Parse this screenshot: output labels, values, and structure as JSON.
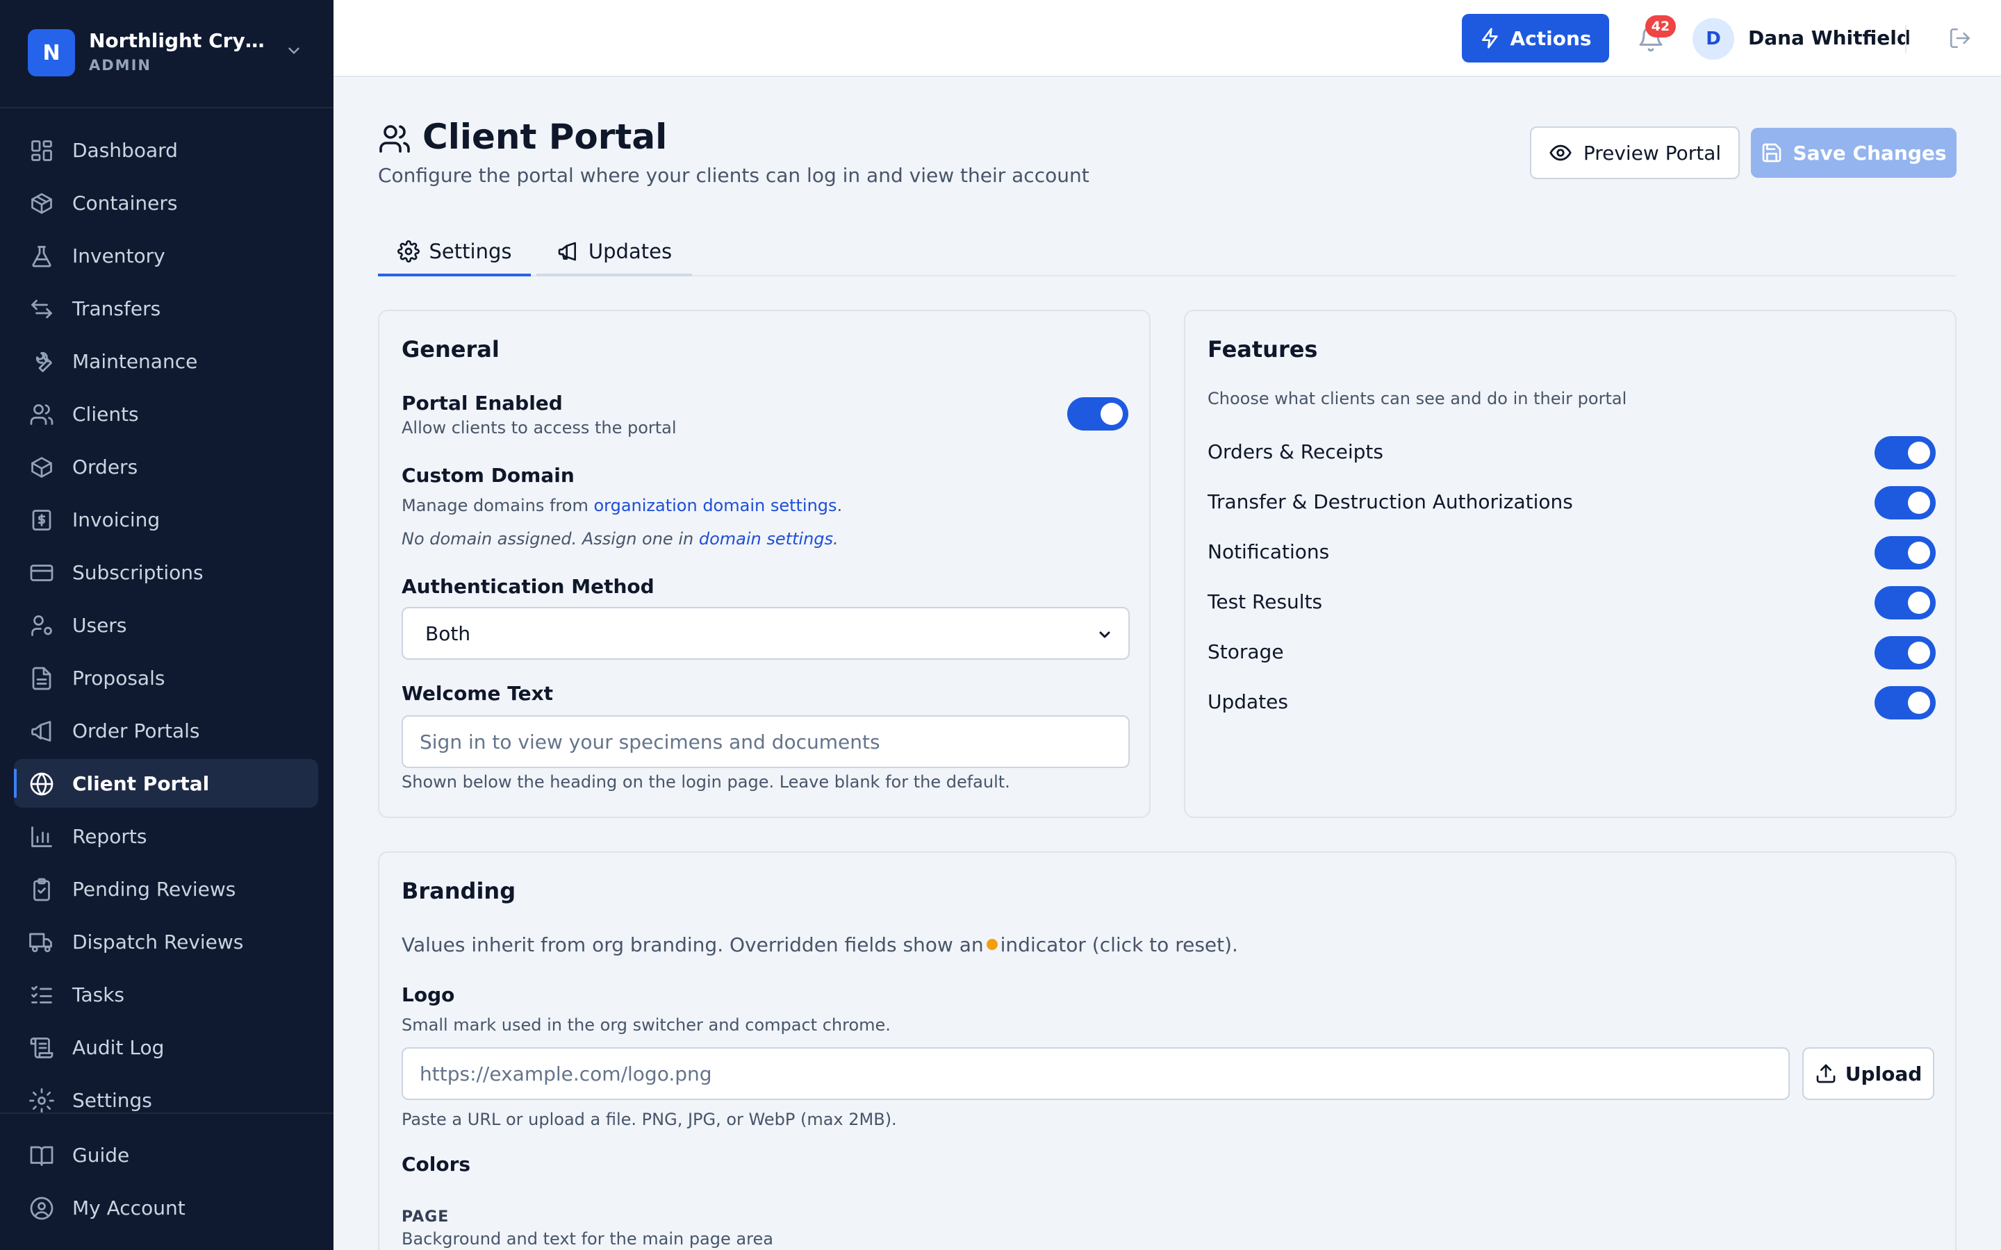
{
  "org": {
    "initial": "N",
    "name": "Northlight Cryobank",
    "role": "ADMIN"
  },
  "nav": {
    "items": [
      {
        "label": "Dashboard",
        "icon": "dashboard-icon"
      },
      {
        "label": "Containers",
        "icon": "box-icon"
      },
      {
        "label": "Inventory",
        "icon": "flask-icon"
      },
      {
        "label": "Transfers",
        "icon": "arrows-icon"
      },
      {
        "label": "Maintenance",
        "icon": "wrench-icon"
      },
      {
        "label": "Clients",
        "icon": "users-icon"
      },
      {
        "label": "Orders",
        "icon": "package-icon"
      },
      {
        "label": "Invoicing",
        "icon": "dollar-icon"
      },
      {
        "label": "Subscriptions",
        "icon": "card-icon"
      },
      {
        "label": "Users",
        "icon": "user-cog-icon"
      },
      {
        "label": "Proposals",
        "icon": "file-icon"
      },
      {
        "label": "Order Portals",
        "icon": "megaphone-icon"
      },
      {
        "label": "Client Portal",
        "icon": "globe-icon",
        "active": true
      },
      {
        "label": "Reports",
        "icon": "bar-chart-icon"
      },
      {
        "label": "Pending Reviews",
        "icon": "clipboard-icon"
      },
      {
        "label": "Dispatch Reviews",
        "icon": "truck-icon"
      },
      {
        "label": "Tasks",
        "icon": "list-check-icon"
      },
      {
        "label": "Audit Log",
        "icon": "scroll-icon"
      },
      {
        "label": "Settings",
        "icon": "gear-icon"
      }
    ],
    "bottom": [
      {
        "label": "Guide",
        "icon": "book-icon"
      },
      {
        "label": "My Account",
        "icon": "account-icon"
      }
    ]
  },
  "topbar": {
    "actions_label": "Actions",
    "notification_count": "42",
    "user_initial": "D",
    "user_name": "Dana Whitfield"
  },
  "header": {
    "title": "Client Portal",
    "subtitle": "Configure the portal where your clients can log in and view their account",
    "preview_label": "Preview Portal",
    "save_label": "Save Changes"
  },
  "tabs": {
    "settings": "Settings",
    "updates": "Updates"
  },
  "general": {
    "title": "General",
    "portal_enabled_label": "Portal Enabled",
    "portal_enabled_desc": "Allow clients to access the portal",
    "portal_enabled": true,
    "custom_domain_label": "Custom Domain",
    "custom_domain_prefix": "Manage domains from ",
    "custom_domain_link": "organization domain settings",
    "custom_domain_suffix": ".",
    "no_domain_prefix": "No domain assigned. Assign one in ",
    "no_domain_link": "domain settings",
    "no_domain_suffix": ".",
    "auth_label": "Authentication Method",
    "auth_value": "Both",
    "welcome_label": "Welcome Text",
    "welcome_placeholder": "Sign in to view your specimens and documents",
    "welcome_help": "Shown below the heading on the login page. Leave blank for the default."
  },
  "features": {
    "title": "Features",
    "desc": "Choose what clients can see and do in their portal",
    "items": [
      {
        "label": "Orders & Receipts",
        "enabled": true
      },
      {
        "label": "Transfer & Destruction Authorizations",
        "enabled": true
      },
      {
        "label": "Notifications",
        "enabled": true
      },
      {
        "label": "Test Results",
        "enabled": true
      },
      {
        "label": "Storage",
        "enabled": true
      },
      {
        "label": "Updates",
        "enabled": true
      }
    ]
  },
  "branding": {
    "title": "Branding",
    "inherit_prefix": "Values inherit from org branding. Overridden fields show an",
    "inherit_suffix": "indicator (click to reset).",
    "logo_label": "Logo",
    "logo_desc": "Small mark used in the org switcher and compact chrome.",
    "logo_placeholder": "https://example.com/logo.png",
    "upload_label": "Upload",
    "logo_help": "Paste a URL or upload a file. PNG, JPG, or WebP (max 2MB).",
    "colors_label": "Colors",
    "page_caps": "PAGE",
    "page_desc": "Background and text for the main page area"
  }
}
